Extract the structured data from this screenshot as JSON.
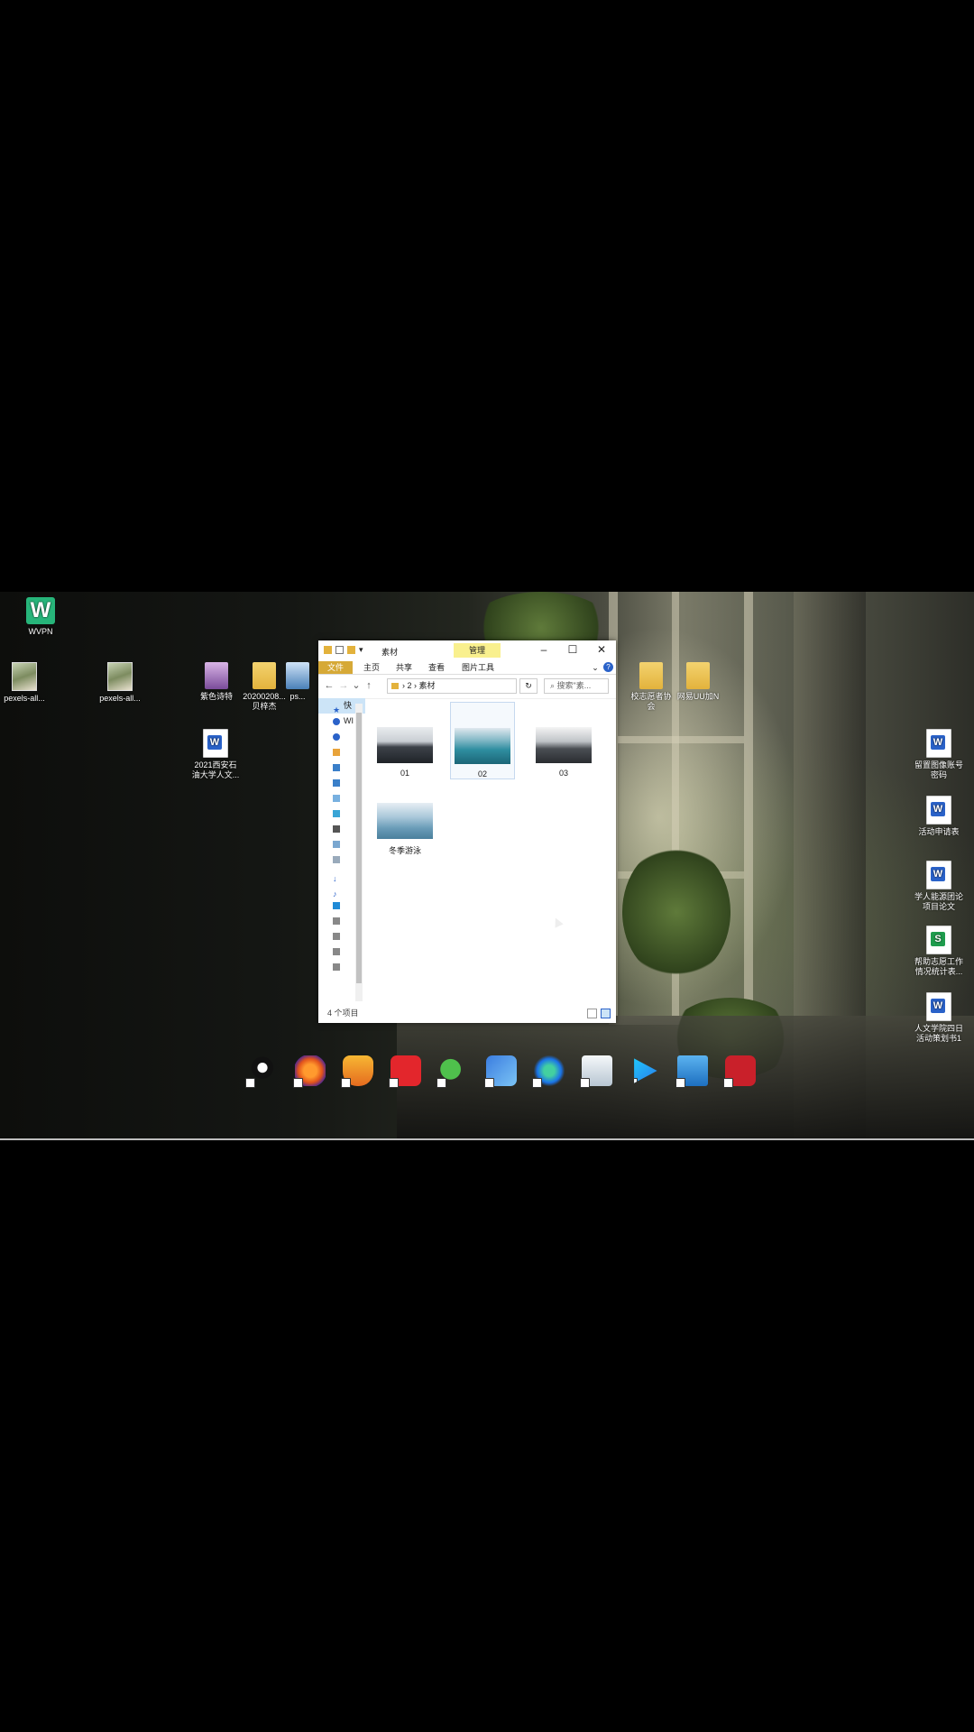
{
  "desktop_icons": {
    "wvpn": "WVPN",
    "pexels1": "pexels-all...",
    "pexels2": "pexels-all...",
    "folder1": "紫色诗特",
    "folder2a": "20200208...",
    "folder2b": "贝梓杰",
    "ps": "ps...",
    "doc_2021a": "2021西安石",
    "doc_2021b": "油大学人文...",
    "folder_r1a": "校志愿者协",
    "folder_r1b": "会",
    "folder_r2": "网易UU加N",
    "doc_r1a": "留置图像账号",
    "doc_r1b": "密码",
    "doc_r2": "活动申请表",
    "doc_r3a": "学人能源团论",
    "doc_r3b": "项目论文",
    "xls_r4a": "帮助志愿工作",
    "xls_r4b": "情况统计表...",
    "doc_r5a": "人文学院四日",
    "doc_r5b": "活动策划书1"
  },
  "explorer": {
    "title": "素材",
    "manage_tab": "管理",
    "ribbon_tabs": {
      "file": "文件",
      "home": "主页",
      "share": "共享",
      "view": "查看",
      "picture_tools": "图片工具"
    },
    "address": {
      "part1": "2",
      "part2": "素材"
    },
    "search_placeholder": "搜索\"素...",
    "nav_items": {
      "quick": "快",
      "onedrive": "WI"
    },
    "files": {
      "f1": "01",
      "f2": "02",
      "f3": "03",
      "f4": "冬季游泳"
    },
    "status": "4 个项目"
  },
  "colors": {
    "file_tab": "#d6a937",
    "manage_tab": "#f9f08e",
    "accent": "#2a62c9"
  },
  "dock_apps": [
    "qq-icon",
    "firefox-icon",
    "security-icon",
    "netease-music-icon",
    "wechat-icon",
    "network-icon",
    "edge-icon",
    "recycle-bin-icon",
    "video-player-icon",
    "computer-icon",
    "game-icon"
  ]
}
